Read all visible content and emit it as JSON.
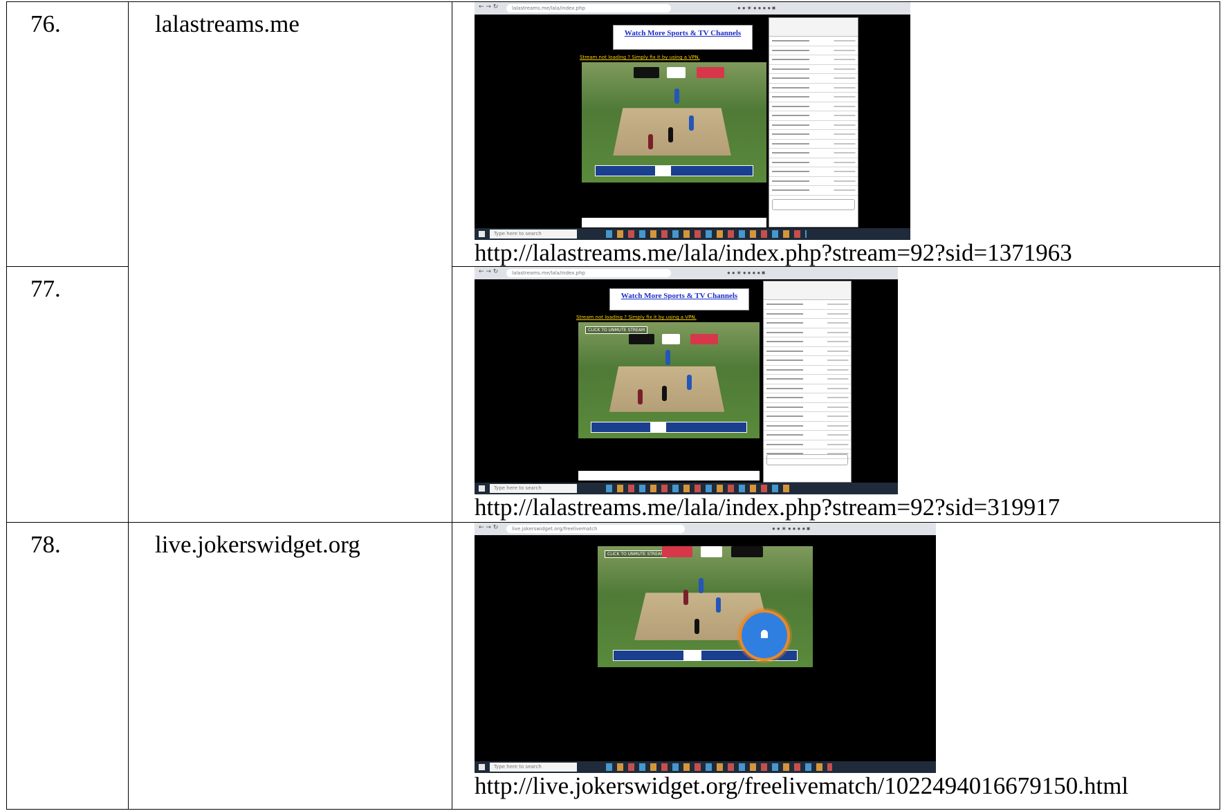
{
  "rows": [
    {
      "number": "76.",
      "site": "lalastreams.me",
      "url": "http://lalastreams.me/lala/index.php?stream=92?sid=1371963",
      "screenshot": {
        "banner": "Watch More Sports & TV Channels",
        "notice": "Stream not loading ? Simply fix it by using a VPN.",
        "taskbar_search": "Type here to search"
      }
    },
    {
      "number": "77.",
      "site": "",
      "url": "http://lalastreams.me/lala/index.php?stream=92?sid=319917",
      "screenshot": {
        "banner": "Watch More Sports & TV Channels",
        "notice": "Stream not loading ? Simply fix it by using a VPN.",
        "unmute": "CLICK TO UNMUTE STREAM",
        "taskbar_search": "Type here to search"
      }
    },
    {
      "number": "78.",
      "site": "live.jokerswidget.org",
      "url": "http://live.jokerswidget.org/freelivematch/1022494016679150.html",
      "screenshot": {
        "unmute": "CLICK TO UNMUTE STREAM",
        "taskbar_search": "Type here to search"
      }
    }
  ],
  "colors": {
    "banner_link": "#1a2cc8",
    "vpn_notice": "#ffd400",
    "bell_button": "#2f7fe0"
  }
}
